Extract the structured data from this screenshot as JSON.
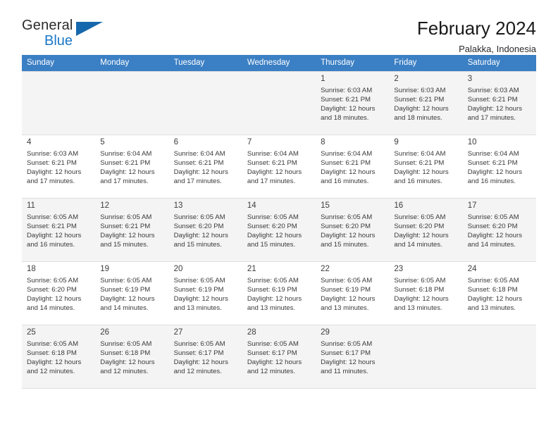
{
  "brand": {
    "name_part1": "General",
    "name_part2": "Blue",
    "logo_icon": "blue-triangle-icon"
  },
  "header": {
    "title": "February 2024",
    "subtitle": "Palakka, Indonesia"
  },
  "calendar": {
    "weekdays": [
      "Sunday",
      "Monday",
      "Tuesday",
      "Wednesday",
      "Thursday",
      "Friday",
      "Saturday"
    ],
    "accent_color": "#3b7fc4",
    "alt_row_color": "#f4f4f4",
    "weeks": [
      [
        {
          "day": ""
        },
        {
          "day": ""
        },
        {
          "day": ""
        },
        {
          "day": ""
        },
        {
          "day": "1",
          "sunrise": "Sunrise: 6:03 AM",
          "sunset": "Sunset: 6:21 PM",
          "daylight1": "Daylight: 12 hours",
          "daylight2": "and 18 minutes."
        },
        {
          "day": "2",
          "sunrise": "Sunrise: 6:03 AM",
          "sunset": "Sunset: 6:21 PM",
          "daylight1": "Daylight: 12 hours",
          "daylight2": "and 18 minutes."
        },
        {
          "day": "3",
          "sunrise": "Sunrise: 6:03 AM",
          "sunset": "Sunset: 6:21 PM",
          "daylight1": "Daylight: 12 hours",
          "daylight2": "and 17 minutes."
        }
      ],
      [
        {
          "day": "4",
          "sunrise": "Sunrise: 6:03 AM",
          "sunset": "Sunset: 6:21 PM",
          "daylight1": "Daylight: 12 hours",
          "daylight2": "and 17 minutes."
        },
        {
          "day": "5",
          "sunrise": "Sunrise: 6:04 AM",
          "sunset": "Sunset: 6:21 PM",
          "daylight1": "Daylight: 12 hours",
          "daylight2": "and 17 minutes."
        },
        {
          "day": "6",
          "sunrise": "Sunrise: 6:04 AM",
          "sunset": "Sunset: 6:21 PM",
          "daylight1": "Daylight: 12 hours",
          "daylight2": "and 17 minutes."
        },
        {
          "day": "7",
          "sunrise": "Sunrise: 6:04 AM",
          "sunset": "Sunset: 6:21 PM",
          "daylight1": "Daylight: 12 hours",
          "daylight2": "and 17 minutes."
        },
        {
          "day": "8",
          "sunrise": "Sunrise: 6:04 AM",
          "sunset": "Sunset: 6:21 PM",
          "daylight1": "Daylight: 12 hours",
          "daylight2": "and 16 minutes."
        },
        {
          "day": "9",
          "sunrise": "Sunrise: 6:04 AM",
          "sunset": "Sunset: 6:21 PM",
          "daylight1": "Daylight: 12 hours",
          "daylight2": "and 16 minutes."
        },
        {
          "day": "10",
          "sunrise": "Sunrise: 6:04 AM",
          "sunset": "Sunset: 6:21 PM",
          "daylight1": "Daylight: 12 hours",
          "daylight2": "and 16 minutes."
        }
      ],
      [
        {
          "day": "11",
          "sunrise": "Sunrise: 6:05 AM",
          "sunset": "Sunset: 6:21 PM",
          "daylight1": "Daylight: 12 hours",
          "daylight2": "and 16 minutes."
        },
        {
          "day": "12",
          "sunrise": "Sunrise: 6:05 AM",
          "sunset": "Sunset: 6:21 PM",
          "daylight1": "Daylight: 12 hours",
          "daylight2": "and 15 minutes."
        },
        {
          "day": "13",
          "sunrise": "Sunrise: 6:05 AM",
          "sunset": "Sunset: 6:20 PM",
          "daylight1": "Daylight: 12 hours",
          "daylight2": "and 15 minutes."
        },
        {
          "day": "14",
          "sunrise": "Sunrise: 6:05 AM",
          "sunset": "Sunset: 6:20 PM",
          "daylight1": "Daylight: 12 hours",
          "daylight2": "and 15 minutes."
        },
        {
          "day": "15",
          "sunrise": "Sunrise: 6:05 AM",
          "sunset": "Sunset: 6:20 PM",
          "daylight1": "Daylight: 12 hours",
          "daylight2": "and 15 minutes."
        },
        {
          "day": "16",
          "sunrise": "Sunrise: 6:05 AM",
          "sunset": "Sunset: 6:20 PM",
          "daylight1": "Daylight: 12 hours",
          "daylight2": "and 14 minutes."
        },
        {
          "day": "17",
          "sunrise": "Sunrise: 6:05 AM",
          "sunset": "Sunset: 6:20 PM",
          "daylight1": "Daylight: 12 hours",
          "daylight2": "and 14 minutes."
        }
      ],
      [
        {
          "day": "18",
          "sunrise": "Sunrise: 6:05 AM",
          "sunset": "Sunset: 6:20 PM",
          "daylight1": "Daylight: 12 hours",
          "daylight2": "and 14 minutes."
        },
        {
          "day": "19",
          "sunrise": "Sunrise: 6:05 AM",
          "sunset": "Sunset: 6:19 PM",
          "daylight1": "Daylight: 12 hours",
          "daylight2": "and 14 minutes."
        },
        {
          "day": "20",
          "sunrise": "Sunrise: 6:05 AM",
          "sunset": "Sunset: 6:19 PM",
          "daylight1": "Daylight: 12 hours",
          "daylight2": "and 13 minutes."
        },
        {
          "day": "21",
          "sunrise": "Sunrise: 6:05 AM",
          "sunset": "Sunset: 6:19 PM",
          "daylight1": "Daylight: 12 hours",
          "daylight2": "and 13 minutes."
        },
        {
          "day": "22",
          "sunrise": "Sunrise: 6:05 AM",
          "sunset": "Sunset: 6:19 PM",
          "daylight1": "Daylight: 12 hours",
          "daylight2": "and 13 minutes."
        },
        {
          "day": "23",
          "sunrise": "Sunrise: 6:05 AM",
          "sunset": "Sunset: 6:18 PM",
          "daylight1": "Daylight: 12 hours",
          "daylight2": "and 13 minutes."
        },
        {
          "day": "24",
          "sunrise": "Sunrise: 6:05 AM",
          "sunset": "Sunset: 6:18 PM",
          "daylight1": "Daylight: 12 hours",
          "daylight2": "and 13 minutes."
        }
      ],
      [
        {
          "day": "25",
          "sunrise": "Sunrise: 6:05 AM",
          "sunset": "Sunset: 6:18 PM",
          "daylight1": "Daylight: 12 hours",
          "daylight2": "and 12 minutes."
        },
        {
          "day": "26",
          "sunrise": "Sunrise: 6:05 AM",
          "sunset": "Sunset: 6:18 PM",
          "daylight1": "Daylight: 12 hours",
          "daylight2": "and 12 minutes."
        },
        {
          "day": "27",
          "sunrise": "Sunrise: 6:05 AM",
          "sunset": "Sunset: 6:17 PM",
          "daylight1": "Daylight: 12 hours",
          "daylight2": "and 12 minutes."
        },
        {
          "day": "28",
          "sunrise": "Sunrise: 6:05 AM",
          "sunset": "Sunset: 6:17 PM",
          "daylight1": "Daylight: 12 hours",
          "daylight2": "and 12 minutes."
        },
        {
          "day": "29",
          "sunrise": "Sunrise: 6:05 AM",
          "sunset": "Sunset: 6:17 PM",
          "daylight1": "Daylight: 12 hours",
          "daylight2": "and 11 minutes."
        },
        {
          "day": ""
        },
        {
          "day": ""
        }
      ]
    ]
  }
}
